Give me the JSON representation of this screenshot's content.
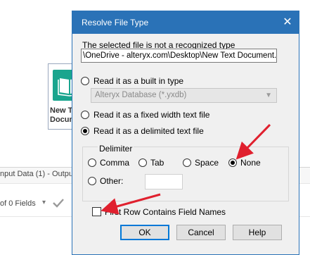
{
  "background": {
    "tool_label_lines": [
      "New T",
      "Docum"
    ],
    "panel_title": "nput Data (1) - Outpu",
    "fields_text": "of 0 Fields",
    "fields_caret": "▾"
  },
  "dialog": {
    "title": "Resolve File Type",
    "close_glyph": "✕",
    "message": "The selected file is not a recognized type",
    "file_path": "\\OneDrive - alteryx.com\\Desktop\\New Text Document.txt",
    "options": {
      "builtin_label": "Read it as a built in type",
      "builtin_select_value": "Alteryx Database (*.yxdb)",
      "fixed_width_label": "Read it as a fixed width text file",
      "delimited_label": "Read it as a delimited text file",
      "selected": "delimited"
    },
    "delimiter": {
      "legend": "Delimiter",
      "comma": "Comma",
      "tab": "Tab",
      "space": "Space",
      "none": "None",
      "other": "Other:",
      "other_value": "",
      "selected": "none"
    },
    "first_row_label": "First Row Contains Field Names",
    "first_row_checked": false,
    "buttons": {
      "ok": "OK",
      "cancel": "Cancel",
      "help": "Help"
    }
  },
  "colors": {
    "titlebar": "#2a72b7",
    "arrow": "#e0202e",
    "tool_icon": "#1aa58e"
  }
}
